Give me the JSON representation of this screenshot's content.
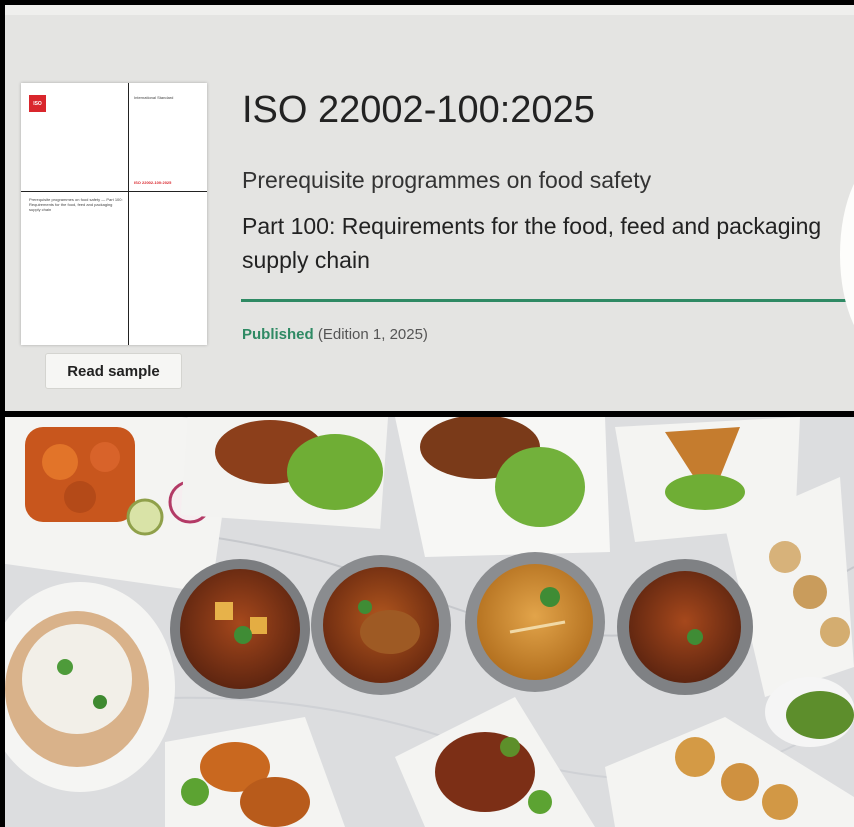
{
  "standard": {
    "code": "ISO 22002-100:2025",
    "subtitle": "Prerequisite programmes on food safety",
    "part_title": "Part 100: Requirements for the food, feed and packaging supply chain",
    "status": "Published",
    "edition": "(Edition 1, 2025)",
    "read_sample_label": "Read sample"
  },
  "cover": {
    "logo_text": "ISO",
    "doc_type": "International Standard",
    "doc_number": "ISO 22002-100:2025",
    "description": "Prerequisite programmes on food safety — Part 100: Requirements for the food, feed and packaging supply chain"
  },
  "photo": {
    "subject": "food-platters-image"
  },
  "colors": {
    "accent_green": "#2f8a64",
    "iso_red": "#d9262c",
    "panel_bg": "#e4e4e2"
  }
}
